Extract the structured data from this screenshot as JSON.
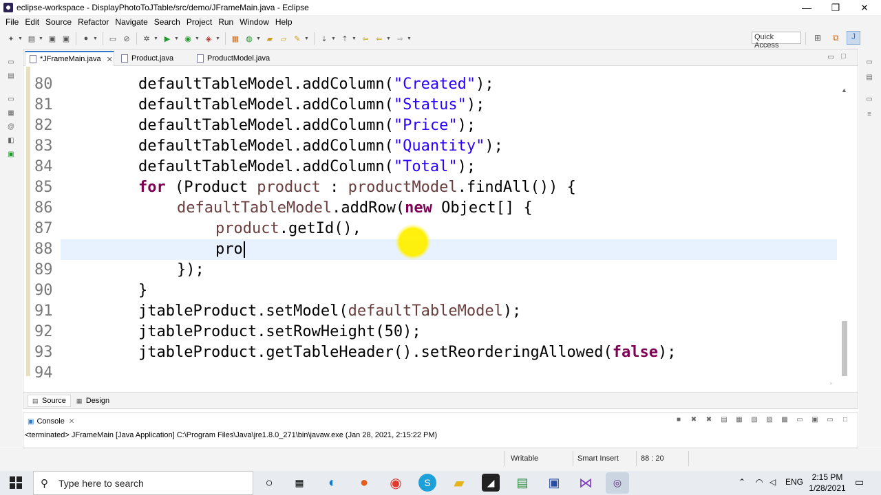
{
  "window": {
    "title": "eclipse-workspace - DisplayPhotoToJTable/src/demo/JFrameMain.java - Eclipse",
    "minimize": "—",
    "maximize": "❐",
    "close": "✕"
  },
  "menu": [
    "File",
    "Edit",
    "Source",
    "Refactor",
    "Navigate",
    "Search",
    "Project",
    "Run",
    "Window",
    "Help"
  ],
  "quick_access": "Quick Access",
  "tabs": [
    {
      "label": "*JFrameMain.java",
      "close": "✕"
    },
    {
      "label": "Product.java"
    },
    {
      "label": "ProductModel.java"
    }
  ],
  "editor_buttons": {
    "minimize": "▭",
    "maximize": "□"
  },
  "code_lines": [
    {
      "num": "80"
    },
    {
      "num": "81"
    },
    {
      "num": "82"
    },
    {
      "num": "83"
    },
    {
      "num": "84"
    },
    {
      "num": "85"
    },
    {
      "num": "86"
    },
    {
      "num": "87"
    },
    {
      "num": "88"
    },
    {
      "num": "89"
    },
    {
      "num": "90"
    },
    {
      "num": "91"
    },
    {
      "num": "92"
    },
    {
      "num": "93"
    },
    {
      "num": "94"
    }
  ],
  "code_tokens": {
    "dtm": "defaultTableModel",
    "addColumn": ".addColumn(",
    "end": ");",
    "created": "\"Created\"",
    "status": "\"Status\"",
    "price": "\"Price\"",
    "quantity": "\"Quantity\"",
    "total": "\"Total\"",
    "for_kw": "for",
    "for_open": " (Product ",
    "product": "product",
    "for_colon": " : ",
    "productModel": "productModel",
    "findAll": ".findAll()) {",
    "addRow": ".addRow(",
    "new_kw": "new",
    "object_arr": " Object[] {",
    "getId": ".getId(),",
    "pro": "pro",
    "close_row": "});",
    "close_brace": "}",
    "jtable": "jtableProduct",
    "setModel": ".setModel(",
    "setRowHeight": ".setRowHeight(50);",
    "getHeader": ".getTableHeader().setReorderingAllowed(",
    "false_kw": "false"
  },
  "bottom_tabs": [
    {
      "label": "Source",
      "icon": "source-icon"
    },
    {
      "label": "Design",
      "icon": "design-icon"
    }
  ],
  "console": {
    "tab": "Console",
    "text": "<terminated> JFrameMain [Java Application] C:\\Program Files\\Java\\jre1.8.0_271\\bin\\javaw.exe (Jan 28, 2021, 2:15:22 PM)"
  },
  "status": {
    "writable": "Writable",
    "insert_mode": "Smart Insert",
    "position": "88 : 20"
  },
  "taskbar": {
    "search_placeholder": "Type here to search",
    "time": "2:15 PM",
    "date": "1/28/2021",
    "lang": "ENG"
  },
  "colors": {
    "keyword": "#7f0055",
    "string": "#2a00ff",
    "current_line": "#e8f2fe",
    "accent": "#2e78c7"
  }
}
